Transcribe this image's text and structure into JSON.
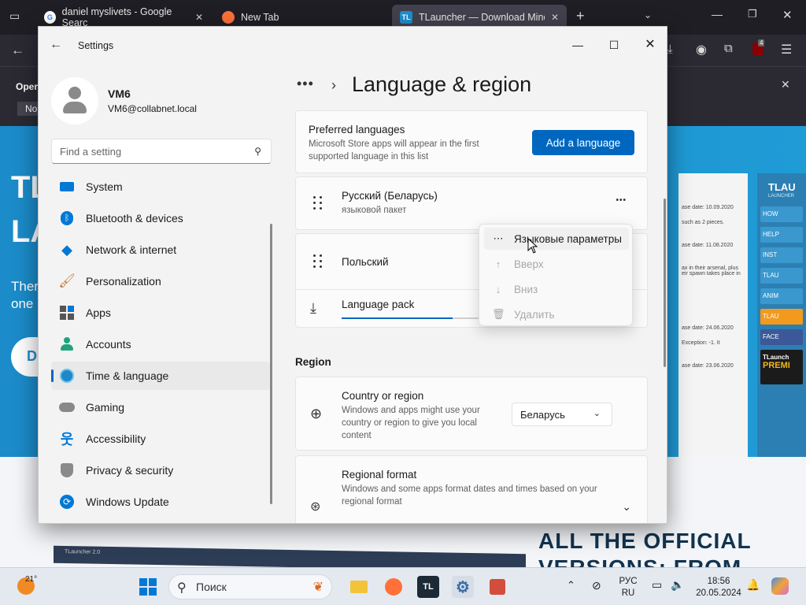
{
  "browser": {
    "tabs": [
      {
        "title": "daniel myslivets - Google Searc",
        "icon": "google-icon"
      },
      {
        "title": "New Tab",
        "icon": "firefox-icon"
      },
      {
        "title": "TLauncher — Download Mine",
        "icon": "tlauncher-icon"
      }
    ],
    "notif_text_1": "Oper",
    "notif_text_2": "No",
    "extension_badge": "4"
  },
  "website": {
    "hero_1": "TL",
    "hero_2": "LA",
    "hero_sub_1": "Ther",
    "hero_sub_2": "one",
    "hero_button": "D",
    "panel_lines": [
      "ase date: 10.09.2020",
      "such as 2 pieces.",
      "ase date: 11.08.2020",
      "ax in their arsenal, plus\neir spawn takes place in",
      "ase date: 24.06.2020",
      "Exception: -1. It",
      "ase date: 23.06.2020"
    ],
    "tl_header": "TLAU",
    "tl_header_sub": "LAUNCHER",
    "tl_items": [
      "HOW",
      "HELP",
      "INST",
      "TLAU",
      "ANIM"
    ],
    "tl_fb": "FACE",
    "tl_tl": "TLAU",
    "tl_promo_1": "TLaunch",
    "tl_promo_2": "PREMI",
    "banner_line_1": "ALL THE OFFICIAL",
    "banner_line_2": "VERSIONS: FROM",
    "bottom_shot_title": "TLauncher 2.0"
  },
  "settings": {
    "window_title": "Settings",
    "user": {
      "name": "VM6",
      "email": "VM6@collabnet.local"
    },
    "search_placeholder": "Find a setting",
    "nav": [
      {
        "label": "System",
        "icon": "system-icon",
        "color": "#0078d4"
      },
      {
        "label": "Bluetooth & devices",
        "icon": "bluetooth-icon",
        "color": "#0078d4"
      },
      {
        "label": "Network & internet",
        "icon": "wifi-icon",
        "color": "#0078d4"
      },
      {
        "label": "Personalization",
        "icon": "brush-icon",
        "color": "#c67a3e"
      },
      {
        "label": "Apps",
        "icon": "apps-icon",
        "color": "#555555"
      },
      {
        "label": "Accounts",
        "icon": "accounts-icon",
        "color": "#20a37a"
      },
      {
        "label": "Time & language",
        "icon": "globe-clock-icon",
        "color": "#1e88c9"
      },
      {
        "label": "Gaming",
        "icon": "gamepad-icon",
        "color": "#777777"
      },
      {
        "label": "Accessibility",
        "icon": "accessibility-icon",
        "color": "#0078d4"
      },
      {
        "label": "Privacy & security",
        "icon": "shield-icon",
        "color": "#777777"
      },
      {
        "label": "Windows Update",
        "icon": "update-icon",
        "color": "#0078d4"
      }
    ],
    "selected_nav": "Time & language",
    "breadcrumb_more": "•••",
    "page_title": "Language & region",
    "preferred": {
      "title": "Preferred languages",
      "desc": "Microsoft Store apps will appear in the first supported language in this list",
      "button": "Add a language"
    },
    "languages": [
      {
        "name": "Русский (Беларусь)",
        "sub": "языковой пакет"
      },
      {
        "name": "Польский",
        "sub": ""
      }
    ],
    "language_pack": {
      "label": "Language pack",
      "progress": 0.8
    },
    "more_glyph": "•••",
    "context_menu": [
      {
        "label": "Языковые параметры",
        "icon": "more-icon",
        "disabled": false
      },
      {
        "label": "Вверх",
        "icon": "arrow-up-icon",
        "disabled": true
      },
      {
        "label": "Вниз",
        "icon": "arrow-down-icon",
        "disabled": true
      },
      {
        "label": "Удалить",
        "icon": "trash-icon",
        "disabled": true
      }
    ],
    "region_header": "Region",
    "country": {
      "title": "Country or region",
      "desc": "Windows and apps might use your country or region to give you local content",
      "value": "Беларусь"
    },
    "regional_format": {
      "title": "Regional format",
      "desc": "Windows and some apps format dates and times based on your regional format"
    }
  },
  "taskbar": {
    "temperature": "21°",
    "search_label": "Поиск",
    "lang_1": "РУС",
    "lang_2": "RU",
    "time": "18:56",
    "date": "20.05.2024"
  }
}
